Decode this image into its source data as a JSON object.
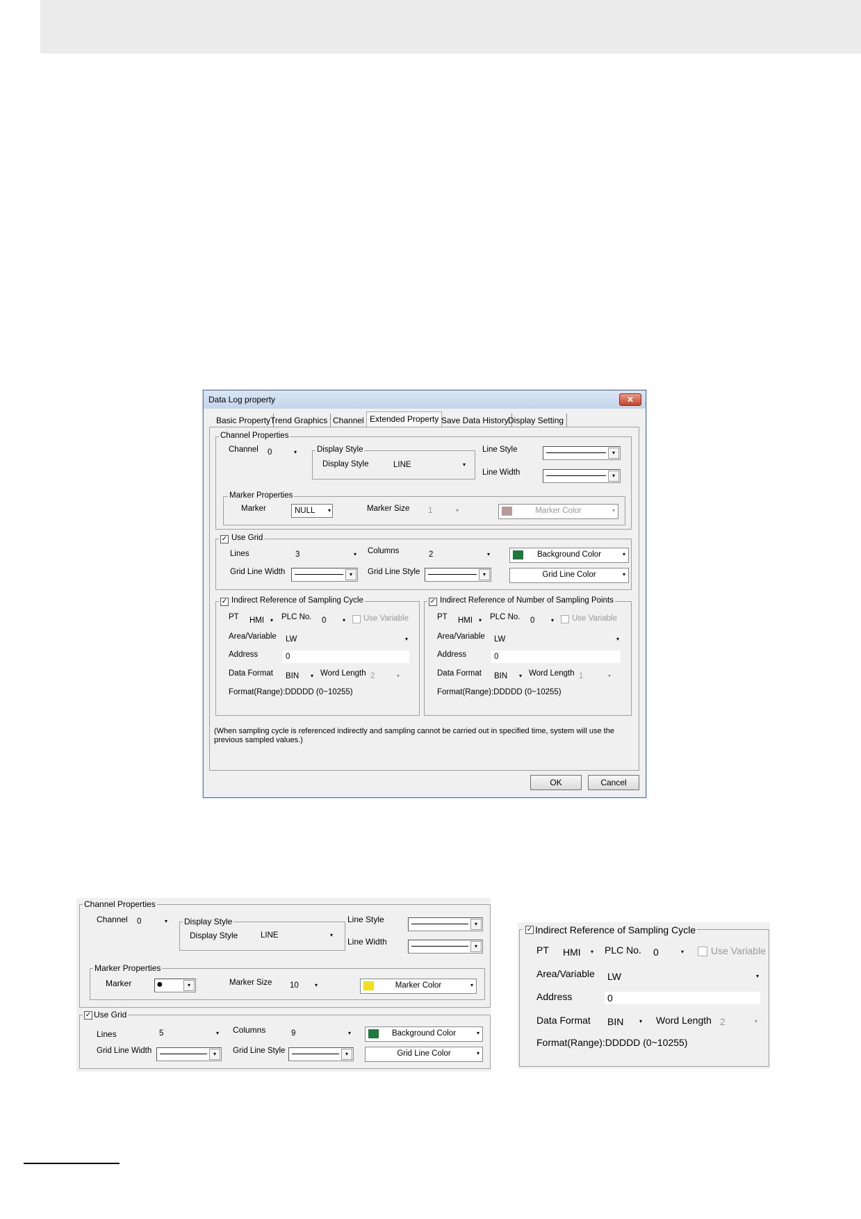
{
  "dialog": {
    "title": "Data Log property",
    "close_glyph": "✕",
    "tabs": [
      "Basic Property",
      "Trend Graphics",
      "Channel",
      "Extended Property",
      "Save Data History",
      "Display Setting"
    ],
    "channel_props": {
      "group_title": "Channel Properties",
      "channel_label": "Channel",
      "channel_value": "0",
      "display_style_group": "Display Style",
      "display_style_label": "Display Style",
      "display_style_value": "LINE",
      "line_style_label": "Line Style",
      "line_width_label": "Line Width",
      "marker_group": "Marker Properties",
      "marker_label": "Marker",
      "marker_value": "NULL",
      "marker_size_label": "Marker Size",
      "marker_size_value": "1",
      "marker_color_label": "Marker Color",
      "marker_color": "#b89a9a"
    },
    "grid": {
      "use_grid_label": "Use Grid",
      "check": "✓",
      "lines_label": "Lines",
      "lines_value": "3",
      "columns_label": "Columns",
      "columns_value": "2",
      "bg_color_label": "Background Color",
      "bg_color": "#1e7a3c",
      "grid_line_width_label": "Grid Line Width",
      "grid_line_style_label": "Grid Line Style",
      "grid_line_color_label": "Grid Line Color"
    },
    "sampling_cycle": {
      "title": "Indirect Reference of Sampling Cycle",
      "pt_label": "PT",
      "pt_value": "HMI",
      "plc_label": "PLC No.",
      "plc_value": "0",
      "use_variable_label": "Use Variable",
      "area_label": "Area/Variable",
      "area_value": "LW",
      "address_label": "Address",
      "address_value": "0",
      "data_format_label": "Data Format",
      "data_format_value": "BIN",
      "word_length_label": "Word Length",
      "word_length_value": "2",
      "format_range": "Format(Range):DDDDD (0~10255)"
    },
    "sampling_points": {
      "title": "Indirect Reference of Number of Sampling Points",
      "pt_label": "PT",
      "pt_value": "HMI",
      "plc_label": "PLC No.",
      "plc_value": "0",
      "use_variable_label": "Use Variable",
      "area_label": "Area/Variable",
      "area_value": "LW",
      "address_label": "Address",
      "address_value": "0",
      "data_format_label": "Data Format",
      "data_format_value": "BIN",
      "word_length_label": "Word Length",
      "word_length_value": "1",
      "format_range": "Format(Range):DDDDD (0~10255)"
    },
    "note": "(When sampling cycle is referenced indirectly and sampling cannot be carried out in specified time, system will use the previous sampled values.)",
    "ok_label": "OK",
    "cancel_label": "Cancel"
  },
  "zoom_channel": {
    "group_title": "Channel Properties",
    "channel_label": "Channel",
    "channel_value": "0",
    "display_style_group": "Display Style",
    "display_style_label": "Display Style",
    "display_style_value": "LINE",
    "line_style_label": "Line Style",
    "line_width_label": "Line Width",
    "marker_group": "Marker Properties",
    "marker_label": "Marker",
    "marker_glyph": "●",
    "marker_size_label": "Marker Size",
    "marker_size_value": "10",
    "marker_color_label": "Marker Color",
    "marker_color": "#f0e020",
    "use_grid_label": "Use Grid",
    "check": "✓",
    "lines_label": "Lines",
    "lines_value": "5",
    "columns_label": "Columns",
    "columns_value": "9",
    "bg_color_label": "Background Color",
    "bg_color": "#1e7a3c",
    "grid_line_width_label": "Grid Line Width",
    "grid_line_style_label": "Grid Line Style",
    "grid_line_color_label": "Grid Line Color"
  },
  "zoom_sampling": {
    "title": "Indirect Reference of Sampling Cycle",
    "check": "✓",
    "pt_label": "PT",
    "pt_value": "HMI",
    "plc_label": "PLC No.",
    "plc_value": "0",
    "use_variable_label": "Use Variable",
    "area_label": "Area/Variable",
    "area_value": "LW",
    "address_label": "Address",
    "address_value": "0",
    "data_format_label": "Data Format",
    "data_format_value": "BIN",
    "word_length_label": "Word Length",
    "word_length_value": "2",
    "format_range": "Format(Range):DDDDD (0~10255)"
  },
  "icons": {
    "dropdown": "▾",
    "checkbox_check": "✓"
  }
}
